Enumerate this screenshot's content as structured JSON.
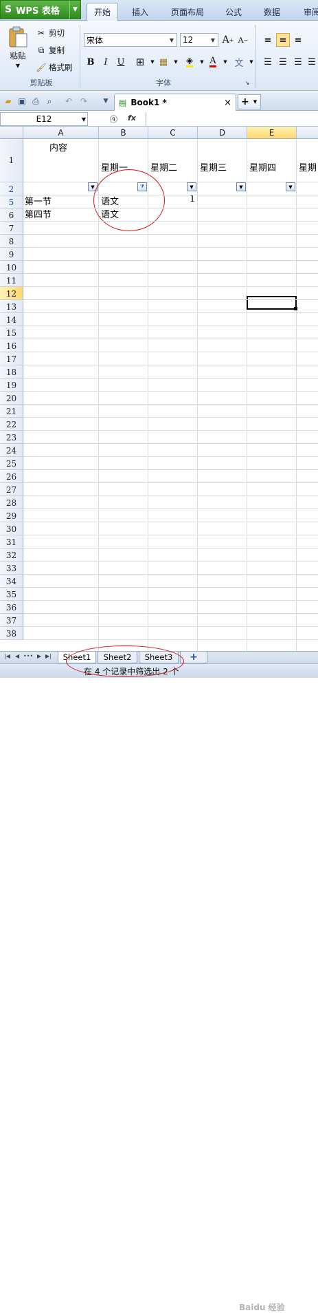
{
  "app": {
    "name": "WPS 表格",
    "logo_glyph": "S"
  },
  "tabs": [
    "开始",
    "插入",
    "页面布局",
    "公式",
    "数据",
    "审阅"
  ],
  "active_tab": "开始",
  "ribbon": {
    "clipboard": {
      "paste": "粘贴",
      "cut": "剪切",
      "copy": "复制",
      "format_painter": "格式刷",
      "group_label": "剪贴板"
    },
    "font": {
      "name": "宋体",
      "size": "12",
      "group_label": "字体",
      "bold": "B",
      "italic": "I",
      "underline": "U",
      "grow": "A",
      "shrink": "A"
    }
  },
  "document": {
    "tab_title": "Book1 *",
    "close_glyph": "×",
    "new_tab_glyph": "+"
  },
  "formula_bar": {
    "name_box": "E12",
    "fx": "fx",
    "formula": ""
  },
  "grid": {
    "columns": [
      "A",
      "B",
      "C",
      "D",
      "E"
    ],
    "partial_column_text": "星期",
    "active_column": "E",
    "header_row": {
      "A": "内容",
      "B": "星期一",
      "C": "星期二",
      "D": "星期三",
      "E": "星期四"
    },
    "rows_visible": [
      "1",
      "2",
      "5",
      "6",
      "7",
      "8",
      "9",
      "10",
      "11",
      "12",
      "13",
      "14",
      "15",
      "16",
      "17",
      "18",
      "19",
      "20",
      "21",
      "22",
      "23",
      "24",
      "25",
      "26",
      "27",
      "28",
      "29",
      "30",
      "31",
      "32",
      "33",
      "34",
      "35",
      "36",
      "37",
      "38"
    ],
    "filtered_row_numbers": [
      "2",
      "5"
    ],
    "active_row": "12",
    "data": [
      {
        "row": "2",
        "A": "第一节",
        "B": "语文",
        "C": "1"
      },
      {
        "row": "5",
        "A": "第四节",
        "B": "语文",
        "C": ""
      }
    ],
    "filter_active_column": "B"
  },
  "sheets": [
    "Sheet1",
    "Sheet2",
    "Sheet3"
  ],
  "active_sheet": "Sheet1",
  "status": "在 4 个记录中筛选出 2 个",
  "watermark": "Baidu 经验",
  "colors": {
    "accent_green": "#3a9a28",
    "annotation_red": "#d41313",
    "active_header": "#ffd86a",
    "row_blue": "#1f4fb5"
  }
}
